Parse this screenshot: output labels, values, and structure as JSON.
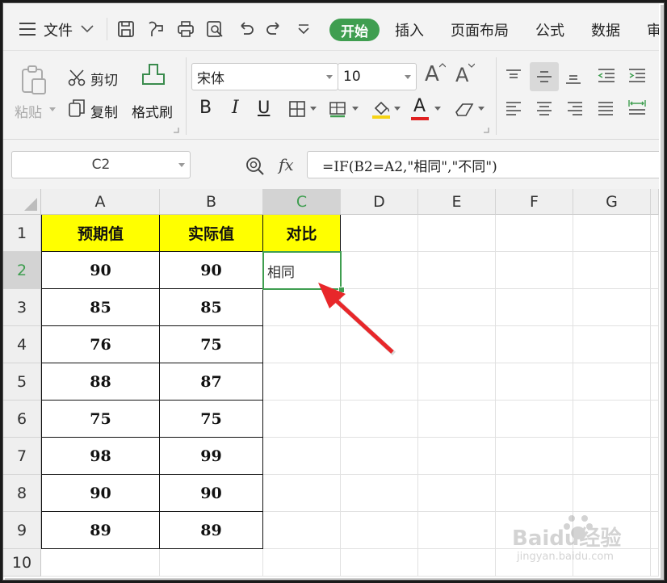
{
  "menu": {
    "file": "文件",
    "start": "开始",
    "tabs": [
      "插入",
      "页面布局",
      "公式",
      "数据",
      "审"
    ]
  },
  "toolbar": {
    "paste": "粘贴",
    "cut": "剪切",
    "copy": "复制",
    "format_painter": "格式刷",
    "font_name": "宋体",
    "font_size": "10",
    "bold": "B",
    "italic": "I",
    "underline": "U",
    "font_color_letter": "A",
    "grow_font": "A",
    "shrink_font": "A"
  },
  "formula_bar": {
    "name_box": "C2",
    "fx": "fx",
    "formula": "=IF(B2=A2,\"相同\",\"不同\")"
  },
  "sheet": {
    "columns": [
      "A",
      "B",
      "C",
      "D",
      "E",
      "F",
      "G"
    ],
    "rows": [
      "1",
      "2",
      "3",
      "4",
      "5",
      "6",
      "7",
      "8",
      "9",
      "10"
    ],
    "header": [
      "预期值",
      "实际值",
      "对比"
    ],
    "data": [
      [
        "90",
        "90"
      ],
      [
        "85",
        "85"
      ],
      [
        "76",
        "75"
      ],
      [
        "88",
        "87"
      ],
      [
        "75",
        "75"
      ],
      [
        "98",
        "99"
      ],
      [
        "90",
        "90"
      ],
      [
        "89",
        "89"
      ]
    ],
    "c2_value": "相同",
    "selected_cell": "C2"
  },
  "colors": {
    "accent": "#3f9e50",
    "header_fill": "#ffff00",
    "arrow": "#e8272a"
  },
  "watermark": "Baidu经验 jingyan.baidu.com"
}
